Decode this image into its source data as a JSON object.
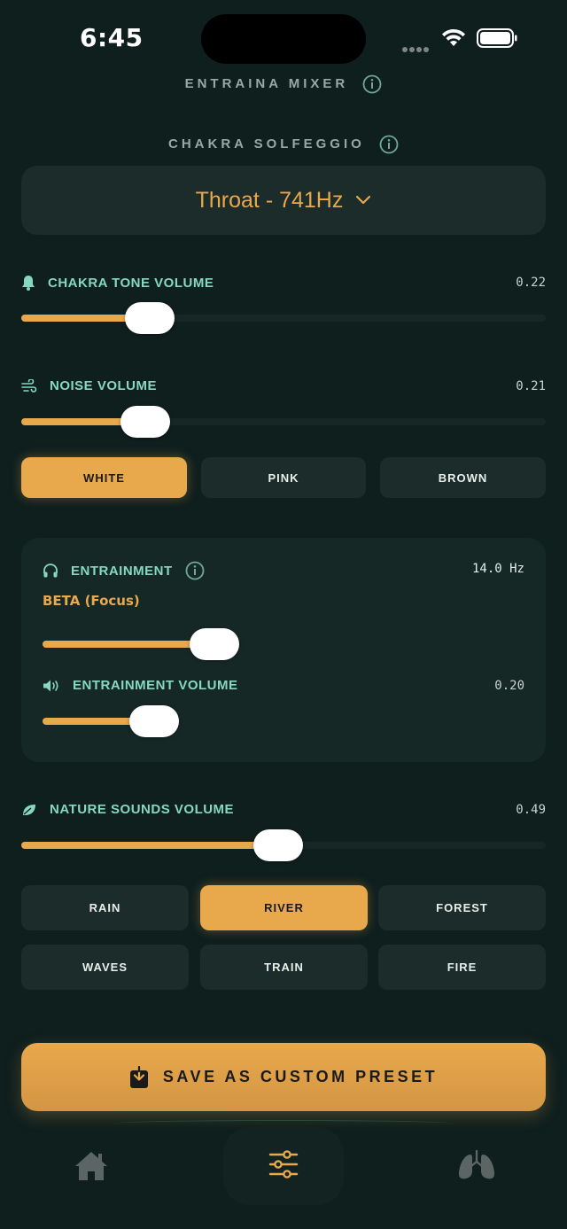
{
  "status_bar": {
    "time": "6:45"
  },
  "header": {
    "title": "ENTRAINA MIXER",
    "info_icon": "info-icon"
  },
  "solfeggio": {
    "title": "CHAKRA SOLFEGGIO",
    "selected": "Throat - 741Hz"
  },
  "chakra_tone": {
    "label": "CHAKRA TONE VOLUME",
    "value": "0.22",
    "level": 0.22
  },
  "noise": {
    "label": "NOISE VOLUME",
    "value": "0.21",
    "level": 0.21,
    "types": [
      "WHITE",
      "PINK",
      "BROWN"
    ],
    "selected": "WHITE"
  },
  "entrainment": {
    "label": "ENTRAINMENT",
    "frequency": "14.0 Hz",
    "band": "BETA (Focus)",
    "level": 0.35,
    "volume_label": "ENTRAINMENT VOLUME",
    "volume_value": "0.20",
    "volume_level": 0.2
  },
  "nature": {
    "label": "NATURE SOUNDS VOLUME",
    "value": "0.49",
    "level": 0.49,
    "sounds": [
      "RAIN",
      "RIVER",
      "FOREST",
      "WAVES",
      "TRAIN",
      "FIRE"
    ],
    "selected": "RIVER"
  },
  "save_button": {
    "label": "SAVE AS CUSTOM PRESET"
  },
  "tabbar": {
    "items": [
      "home-icon",
      "sliders-icon",
      "lungs-icon"
    ],
    "active": "sliders-icon"
  },
  "colors": {
    "accent": "#e8a84c",
    "teal": "#86d8be",
    "background": "#0f1f1e"
  }
}
